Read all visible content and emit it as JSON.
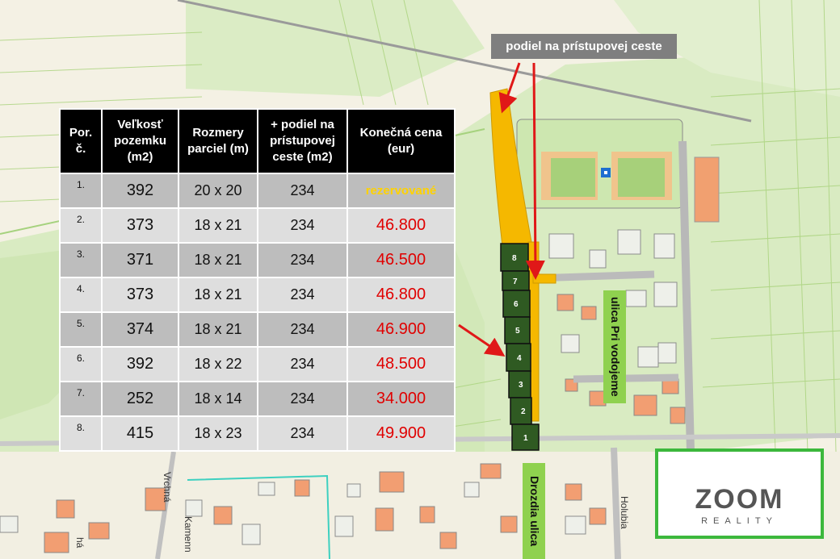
{
  "table": {
    "headers": [
      "Por. č.",
      "Veľkosť pozemku (m2)",
      "Rozmery parciel (m)",
      "+ podiel na prístupovej ceste (m2)",
      "Konečná cena (eur)"
    ],
    "rows": [
      {
        "num": "1.",
        "size": "392",
        "dims": "20 x 20",
        "share": "234",
        "price": "rezervované",
        "reserved": true
      },
      {
        "num": "2.",
        "size": "373",
        "dims": "18 x 21",
        "share": "234",
        "price": "46.800"
      },
      {
        "num": "3.",
        "size": "371",
        "dims": "18 x 21",
        "share": "234",
        "price": "46.500"
      },
      {
        "num": "4.",
        "size": "373",
        "dims": "18 x 21",
        "share": "234",
        "price": "46.800"
      },
      {
        "num": "5.",
        "size": "374",
        "dims": "18 x 21",
        "share": "234",
        "price": "46.900"
      },
      {
        "num": "6.",
        "size": "392",
        "dims": "18 x 22",
        "share": "234",
        "price": "48.500"
      },
      {
        "num": "7.",
        "size": "252",
        "dims": "18 x 14",
        "share": "234",
        "price": "34.000"
      },
      {
        "num": "8.",
        "size": "415",
        "dims": "18 x 23",
        "share": "234",
        "price": "49.900"
      }
    ]
  },
  "callout": "podiel na prístupovej ceste",
  "street_labels": {
    "pri_vodojeme": "ulica Pri vodojeme",
    "drozdia": "Drozdia ulica",
    "vrchna": "Vrchná",
    "kamenna": "Kamenn",
    "holubia": "Holubia",
    "ha": "há"
  },
  "plots": [
    "8",
    "7",
    "6",
    "5",
    "4",
    "3",
    "2",
    "1"
  ],
  "logo": {
    "word": "ZOOM",
    "sub": "REALITY"
  },
  "colors": {
    "access_road": "#f5b800",
    "plot_fill": "#2f5a22",
    "street_label_bg": "#8fd14f",
    "price": "#e00000",
    "reserved": "#ffd200",
    "logo_border": "#3cb83c"
  }
}
